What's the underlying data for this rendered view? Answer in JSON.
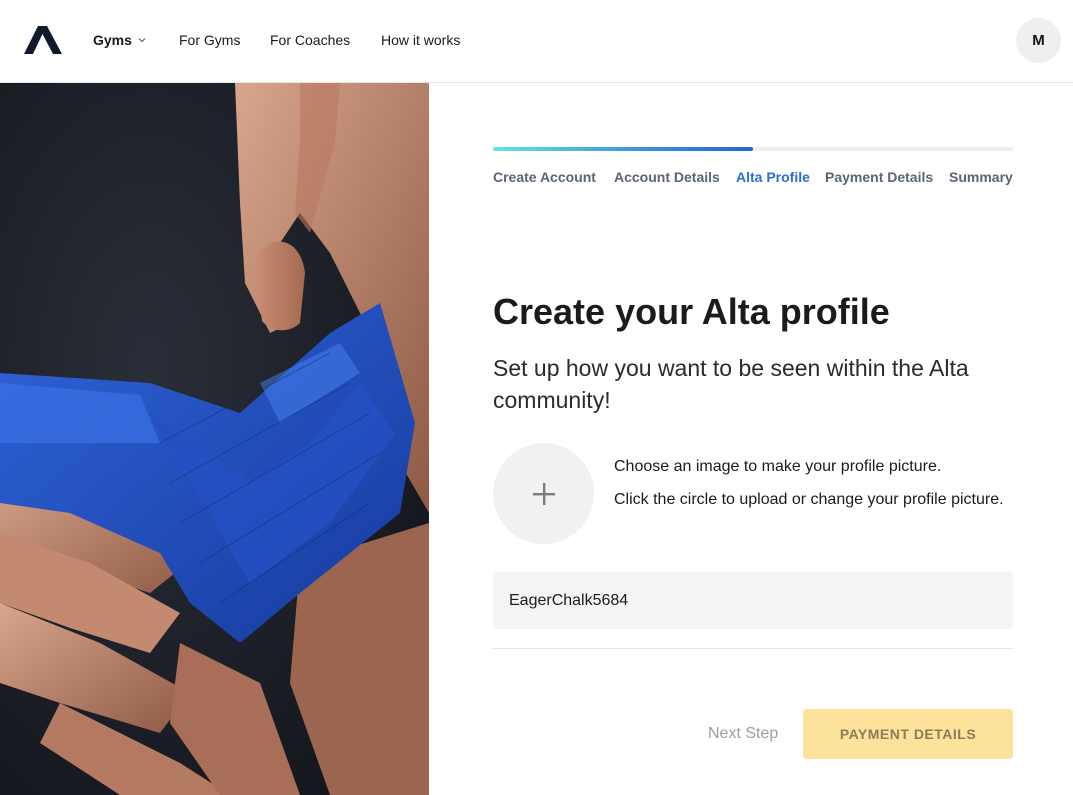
{
  "header": {
    "nav": {
      "gyms": "Gyms",
      "for_gyms": "For Gyms",
      "for_coaches": "For Coaches",
      "how_it_works": "How it works"
    },
    "avatar_initial": "M"
  },
  "progress": {
    "value": 0.5,
    "steps": [
      {
        "label": "Create Account",
        "state": "done"
      },
      {
        "label": "Account Details",
        "state": "done"
      },
      {
        "label": "Alta Profile",
        "state": "active"
      },
      {
        "label": "Payment Details",
        "state": "pending"
      },
      {
        "label": "Summary",
        "state": "pending"
      }
    ]
  },
  "main": {
    "title": "Create your Alta profile",
    "subtitle": "Set up how you want to be seen within the Alta community!",
    "upload_info_1": "Choose an image to make your profile picture.",
    "upload_info_2": "Click the circle to upload or change your profile picture.",
    "upload_icon": "plus-icon",
    "username_value": "EagerChalk5684"
  },
  "footer": {
    "next_step_label": "Next Step",
    "next_button_label": "PAYMENT DETAILS"
  },
  "colors": {
    "accent": "#2a6fd4",
    "progress_start": "#5ee7df",
    "progress_end": "#2567c9",
    "cta_disabled": "#fde29b",
    "input_bg": "#f4f4f5"
  }
}
